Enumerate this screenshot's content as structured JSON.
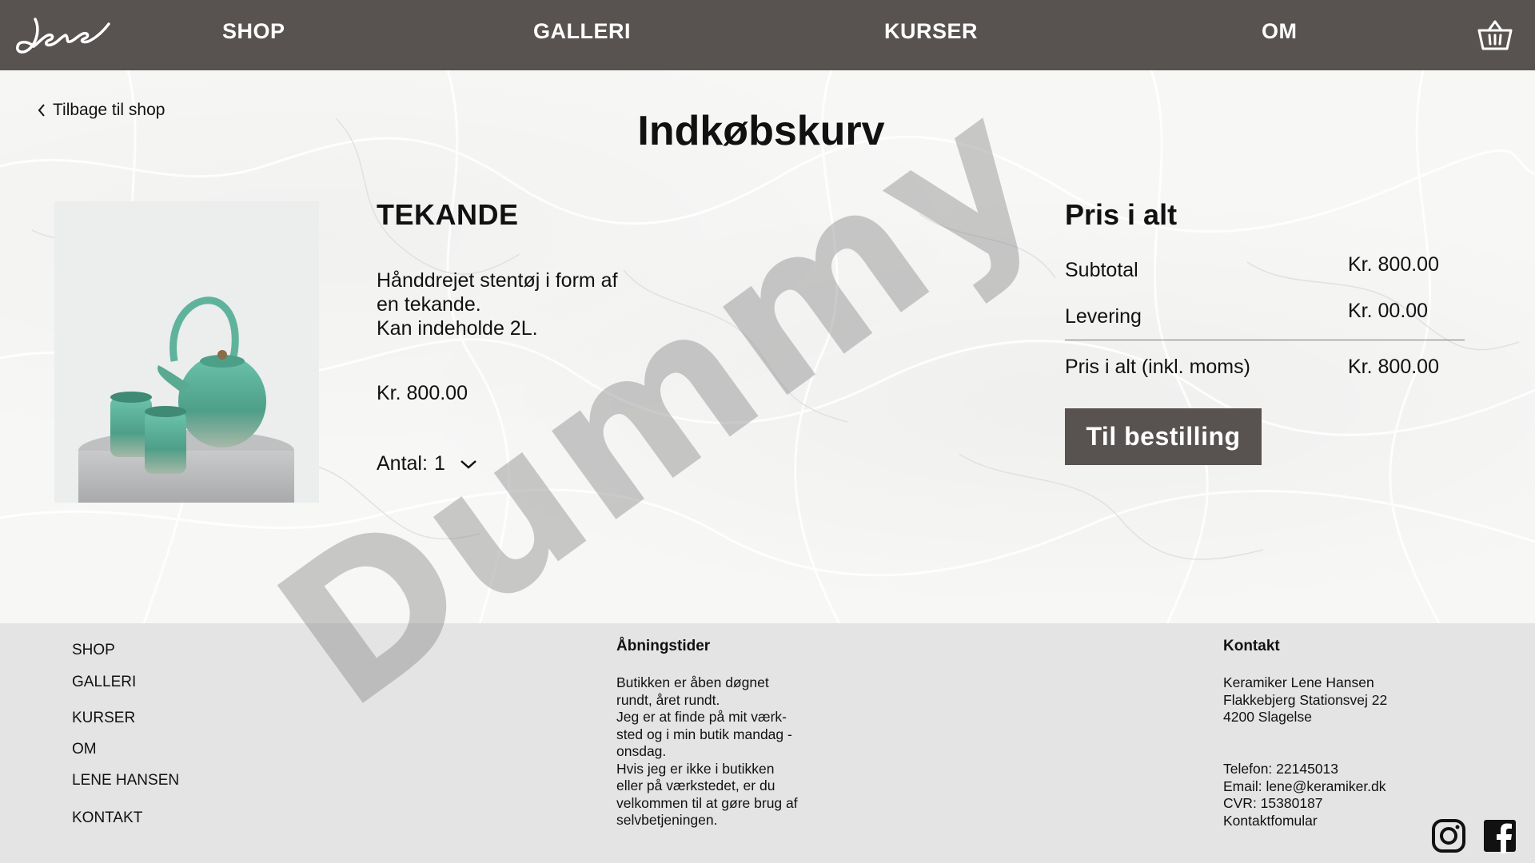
{
  "header": {
    "nav": [
      "SHOP",
      "GALLERI",
      "KURSER",
      "OM"
    ]
  },
  "main": {
    "back_label": "Tilbage til shop",
    "title": "Indkøbskurv",
    "product": {
      "name": "TEKANDE",
      "description": [
        "Hånddrejet stentøj i form af",
        "en tekande.",
        "Kan indeholde 2L."
      ],
      "price": "Kr. 800.00",
      "quantity_label": "Antal:",
      "quantity_value": "1"
    },
    "summary": {
      "title": "Pris i alt",
      "rows": [
        {
          "label": "Subtotal",
          "value": "Kr. 800.00"
        },
        {
          "label": "Levering",
          "value": "Kr. 00.00"
        },
        {
          "label": "Pris i alt (inkl. moms)",
          "value": "Kr. 800.00"
        }
      ],
      "order_button": "Til bestilling"
    },
    "watermark": "Dummy"
  },
  "footer": {
    "links": [
      "SHOP",
      "GALLERI",
      "KURSER",
      "OM",
      "LENE HANSEN",
      "KONTAKT"
    ],
    "hours": {
      "heading": "Åbningstider",
      "lines": [
        "Butikken er åben døgnet",
        "rundt, året rundt.",
        "Jeg er at finde på mit værk-",
        "sted og i min butik mandag -",
        "onsdag.",
        "Hvis jeg er ikke i butikken",
        "eller på værkstedet, er du",
        "velkommen til at gøre brug af",
        "selvbetjeningen."
      ]
    },
    "contact": {
      "heading": "Kontakt",
      "address": [
        "Keramiker Lene Hansen",
        "Flakkebjerg Stationsvej 22",
        "4200 Slagelse"
      ],
      "details": [
        "Telefon: 22145013",
        "Email: lene@keramiker.dk",
        "CVR: 15380187",
        "Kontaktfomular"
      ]
    }
  },
  "colors": {
    "header_bg": "#585250",
    "button_bg": "#585250",
    "footer_bg": "#e4e4e4",
    "glaze": "#5fb39c"
  },
  "icons": [
    "logo-signature",
    "basket-icon",
    "chevron-left-icon",
    "chevron-down-icon",
    "instagram-icon",
    "facebook-icon"
  ]
}
